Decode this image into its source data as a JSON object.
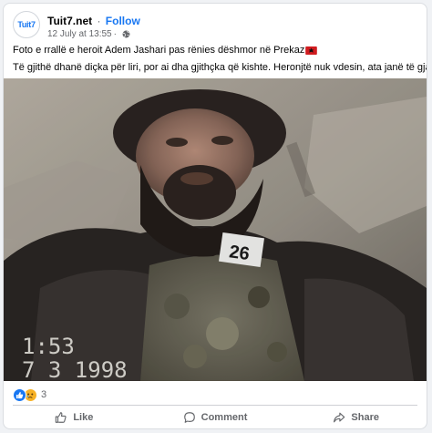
{
  "post": {
    "author": "Tuit7.net",
    "separator": "·",
    "follow_label": "Follow",
    "timestamp": "12 July at 13:55",
    "meta_separator": "·",
    "avatar_text": "Tuit7",
    "privacy_icon": "globe-icon",
    "text_line1": "Foto e rrallë e heroit Adem Jashari pas rënies dëshmor në Prekaz",
    "flag_emoji": "albanian-flag",
    "text_line2": "Të gjithë dhanë diçka për liri, por ai dha gjithçka që kishte. Heronjtë nuk vdesin, ata janë të gjallë.",
    "photo": {
      "tag_number": "26",
      "date_stamp_line1": "1:53",
      "date_stamp_line2": "7  3  1998"
    }
  },
  "reactions": {
    "icons": [
      "like-icon",
      "sad-icon"
    ],
    "count": "3"
  },
  "actions": {
    "like_label": "Like",
    "comment_label": "Comment",
    "share_label": "Share"
  },
  "colors": {
    "accent": "#1877f2",
    "secondary_text": "#65676b",
    "background": "#f0f2f5"
  }
}
